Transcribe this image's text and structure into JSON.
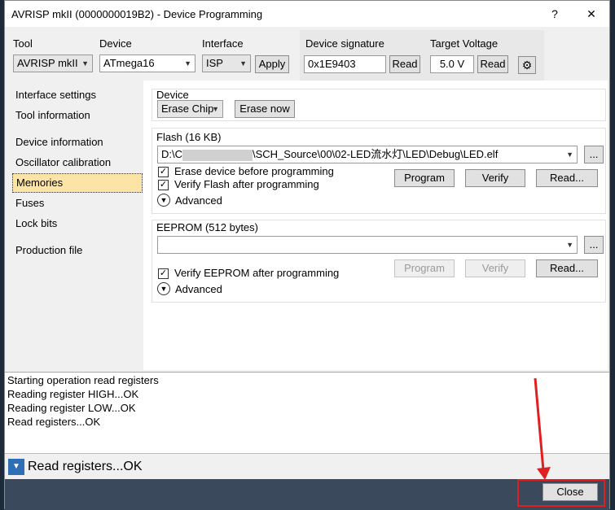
{
  "window": {
    "title": "AVRISP mkII (0000000019B2) - Device Programming",
    "help_label": "?",
    "close_label": "✕"
  },
  "toolbar": {
    "tool_label": "Tool",
    "tool_value": "AVRISP mkII",
    "device_label": "Device",
    "device_value": "ATmega16",
    "interface_label": "Interface",
    "interface_value": "ISP",
    "apply_label": "Apply",
    "signature_label": "Device signature",
    "signature_value": "0x1E9403",
    "signature_read_label": "Read",
    "voltage_label": "Target Voltage",
    "voltage_value": "5.0 V",
    "voltage_read_label": "Read"
  },
  "sidebar": {
    "items": [
      {
        "label": "Interface settings"
      },
      {
        "label": "Tool information"
      },
      {
        "label": "Device information"
      },
      {
        "label": "Oscillator calibration"
      },
      {
        "label": "Memories"
      },
      {
        "label": "Fuses"
      },
      {
        "label": "Lock bits"
      },
      {
        "label": "Production file"
      }
    ]
  },
  "device_section": {
    "title": "Device",
    "erase_option": "Erase Chip",
    "erase_now_label": "Erase now"
  },
  "flash_section": {
    "title": "Flash (16 KB)",
    "path_prefix": "D:\\C",
    "path_suffix": "\\SCH_Source\\00\\02-LED流水灯\\LED\\Debug\\LED.elf",
    "browse_label": "...",
    "erase_before_label": "Erase device before programming",
    "verify_after_label": "Verify Flash after programming",
    "advanced_label": "Advanced",
    "program_label": "Program",
    "verify_label": "Verify",
    "read_label": "Read..."
  },
  "eeprom_section": {
    "title": "EEPROM (512 bytes)",
    "path_value": "",
    "browse_label": "...",
    "verify_after_label": "Verify EEPROM after programming",
    "advanced_label": "Advanced",
    "program_label": "Program",
    "verify_label": "Verify",
    "read_label": "Read..."
  },
  "log": {
    "lines": [
      "Starting operation read registers",
      "Reading register HIGH...OK",
      "Reading register LOW...OK",
      "Read registers...OK"
    ]
  },
  "status": {
    "text": "Read registers...OK"
  },
  "footer": {
    "close_label": "Close"
  },
  "colors": {
    "selected_bg": "#fce4a6",
    "highlight_red": "#e02020"
  }
}
